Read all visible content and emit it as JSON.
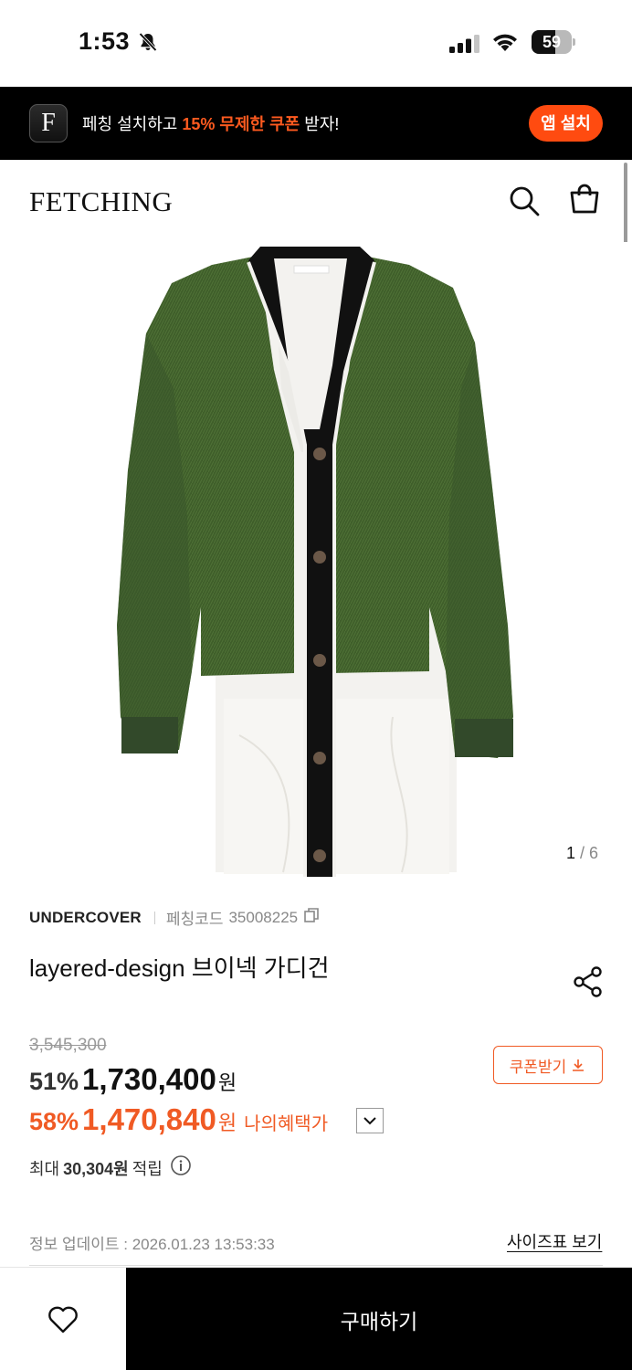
{
  "status_bar": {
    "time": "1:53",
    "battery": "59",
    "battery_level": 0.59,
    "icons": [
      "bell-slash-icon",
      "cellular-signal-icon",
      "wifi-icon",
      "battery-icon"
    ]
  },
  "app_banner": {
    "app_icon_letter": "F",
    "message_prefix": "페칭 설치하고 ",
    "message_highlight": "15% 무제한 쿠폰",
    "message_suffix": " 받자!",
    "install_label": "앱 설치",
    "accent_color": "#ff4b10"
  },
  "header": {
    "logo": "FETCHING",
    "icons": [
      "search-icon",
      "shopping-bag-icon"
    ]
  },
  "gallery": {
    "current": "1",
    "separator": " / ",
    "total": "6"
  },
  "product": {
    "brand": "UNDERCOVER",
    "code_label": "페칭코드",
    "code_value": "35008225",
    "title": "layered-design 브이넥 가디건",
    "original_price": "3,545,300",
    "discount_pct": "51%",
    "sale_price": "1,730,400",
    "currency": "원",
    "benefit_pct": "58%",
    "benefit_price": "1,470,840",
    "benefit_label": "나의혜택가",
    "coupon_label": "쿠폰받기",
    "points_prefix": "최대",
    "points_value": "30,304원",
    "points_suffix": "적립",
    "update_info": "정보 업데이트 : 2026.01.23 13:53:33",
    "size_chart_link": "사이즈표 보기",
    "highlight_color": "#f05a24"
  },
  "bottom_bar": {
    "buy_label": "구매하기",
    "wish_icon": "heart-icon"
  }
}
